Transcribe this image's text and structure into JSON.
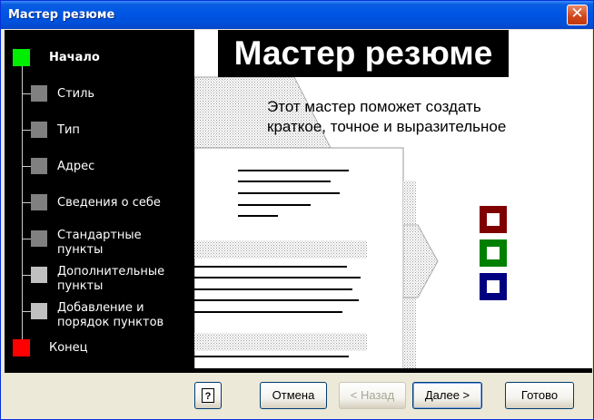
{
  "window": {
    "title": "Мастер резюме"
  },
  "steps": [
    {
      "label": "Начало",
      "state": "current",
      "color": "#00ee00"
    },
    {
      "label": "Стиль",
      "state": "pending",
      "color": "#808080"
    },
    {
      "label": "Тип",
      "state": "pending",
      "color": "#808080"
    },
    {
      "label": "Адрес",
      "state": "pending",
      "color": "#808080"
    },
    {
      "label": "Сведения о себе",
      "state": "pending",
      "color": "#808080"
    },
    {
      "label": "Стандартные\nпункты",
      "state": "pending",
      "color": "#808080"
    },
    {
      "label": "Дополнительные\nпункты",
      "state": "pending",
      "color": "#c0c0c0"
    },
    {
      "label": "Добавление и\nпорядок пунктов",
      "state": "pending",
      "color": "#c0c0c0"
    },
    {
      "label": "Конец",
      "state": "final",
      "color": "#ff0000"
    }
  ],
  "main": {
    "heading": "Мастер резюме",
    "intro_line1": "Этот мастер поможет создать",
    "intro_line2": "краткое, точное и выразительное"
  },
  "illustration": {
    "color_boxes": [
      "#800000",
      "#008000",
      "#000080"
    ]
  },
  "buttons": {
    "help": "?",
    "cancel": "Отмена",
    "back": "< Назад",
    "next": "Далее >",
    "finish": "Готово"
  }
}
